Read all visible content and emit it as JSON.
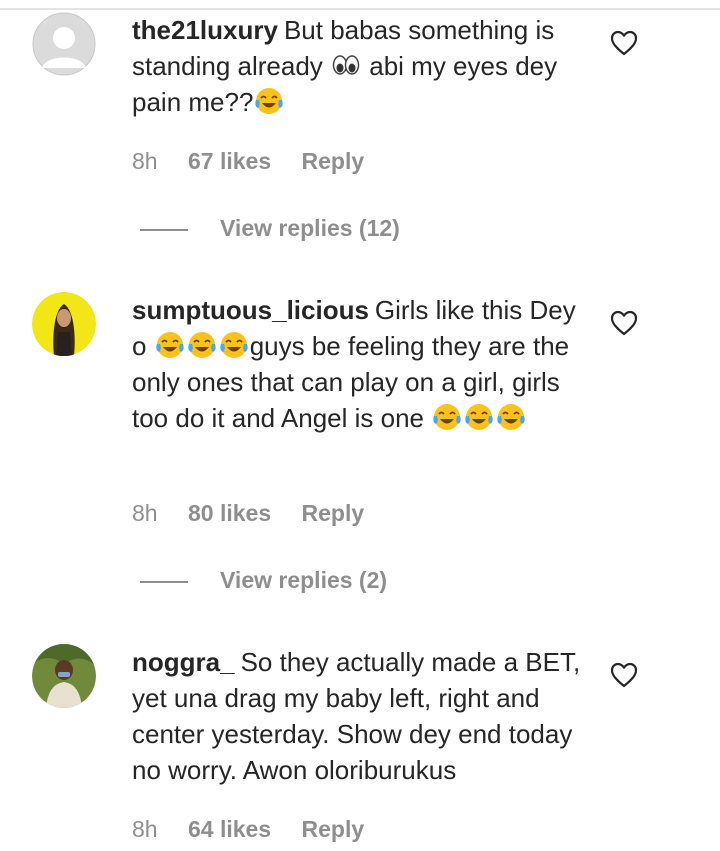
{
  "comments": [
    {
      "username": "the21luxury",
      "text_parts": [
        "But babas something is standing already ",
        " abi my eyes dey pain me??",
        ""
      ],
      "emoji_names": [
        "eyes-emoji",
        "tears-of-joy-emoji"
      ],
      "time": "8h",
      "likes": "67 likes",
      "reply": "Reply",
      "view_replies": "View replies (12)",
      "avatar": "default-avatar-icon"
    },
    {
      "username": "sumptuous_licious",
      "text_parts": [
        "Girls like this Dey o ",
        "",
        "",
        "guys be feeling they are the only ones that can play on a girl, girls too do it and Angel is one ",
        "",
        "",
        ""
      ],
      "emoji_names": [
        "tears-of-joy-emoji",
        "tears-of-joy-emoji",
        "tears-of-joy-emoji",
        "tears-of-joy-emoji",
        "tears-of-joy-emoji",
        "tears-of-joy-emoji"
      ],
      "time": "8h",
      "likes": "80 likes",
      "reply": "Reply",
      "view_replies": "View replies (2)",
      "avatar": "user-photo-avatar"
    },
    {
      "username": "noggra_",
      "text_parts": [
        "So they actually made a BET, yet una drag my baby left, right and center yesterday. Show dey end today no worry. Awon oloriburukus"
      ],
      "emoji_names": [],
      "time": "8h",
      "likes": "64 likes",
      "reply": "Reply",
      "avatar": "user-photo-avatar"
    }
  ],
  "colors": {
    "text": "#262626",
    "muted": "#8e8e8e",
    "avatar_yellow": "#f2e617"
  }
}
